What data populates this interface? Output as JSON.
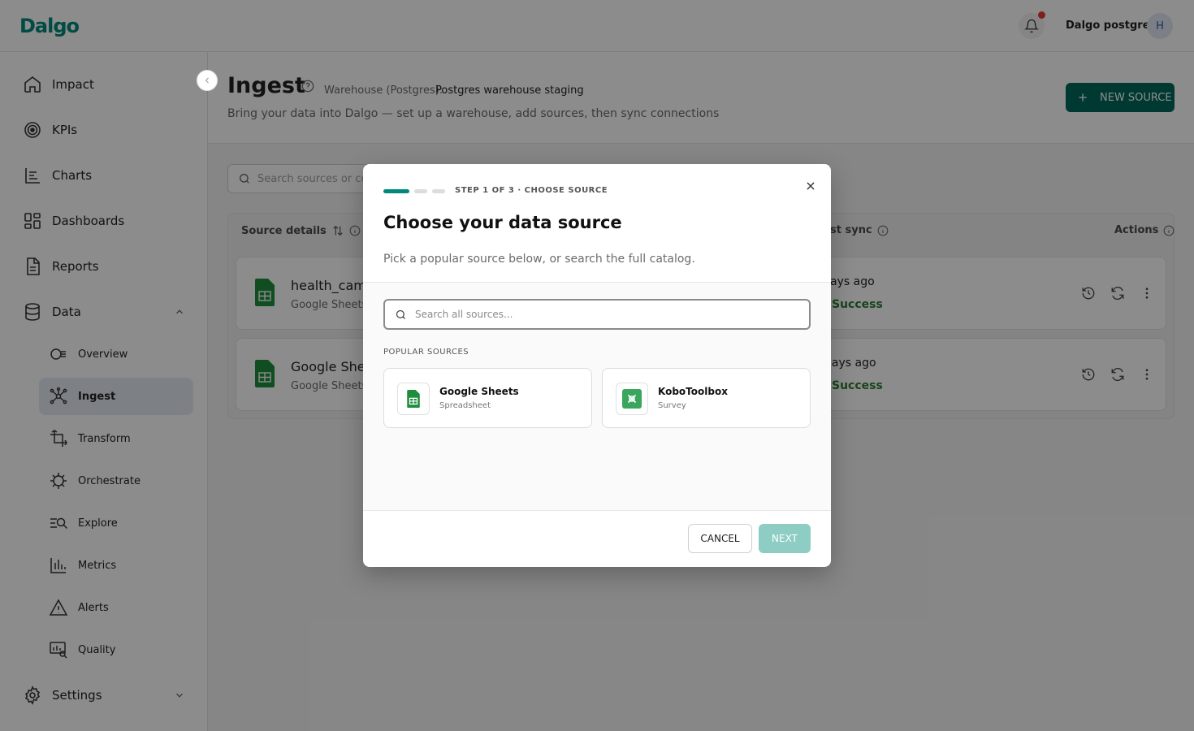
{
  "header": {
    "logo": "Dalgo",
    "user_name": "Dalgo postgres",
    "avatar_initial": "H"
  },
  "sidebar": {
    "items": [
      {
        "label": "Impact",
        "icon": "home-icon"
      },
      {
        "label": "KPIs",
        "icon": "target-icon"
      },
      {
        "label": "Charts",
        "icon": "chart-icon"
      },
      {
        "label": "Dashboards",
        "icon": "dashboard-icon"
      },
      {
        "label": "Reports",
        "icon": "report-icon"
      },
      {
        "label": "Data",
        "icon": "database-icon"
      },
      {
        "label": "Settings",
        "icon": "gear-icon"
      }
    ],
    "data_sub": [
      {
        "label": "Overview",
        "icon": "overview-icon"
      },
      {
        "label": "Ingest",
        "icon": "ingest-icon",
        "active": true
      },
      {
        "label": "Transform",
        "icon": "transform-icon"
      },
      {
        "label": "Orchestrate",
        "icon": "orchestrate-icon"
      },
      {
        "label": "Explore",
        "icon": "explore-icon"
      },
      {
        "label": "Metrics",
        "icon": "metrics-icon"
      },
      {
        "label": "Alerts",
        "icon": "alert-icon"
      },
      {
        "label": "Quality",
        "icon": "quality-icon"
      }
    ]
  },
  "page": {
    "title": "Ingest",
    "warehouse_label": "Warehouse (Postgres):",
    "warehouse_value": "Postgres warehouse staging",
    "subtitle": "Bring your data into Dalgo — set up a warehouse, add sources, then sync connections",
    "new_source_label": "NEW SOURCE",
    "search_placeholder": "Search sources or conn"
  },
  "table": {
    "col_source": "Source details",
    "col_sync": "st sync",
    "col_actions": "Actions",
    "rows": [
      {
        "name": "health_cam",
        "type": "Google Sheets",
        "time": "ays ago",
        "status": "Success"
      },
      {
        "name": "Google Shee",
        "type": "Google Sheets",
        "time": "lays ago",
        "status": "Success"
      }
    ]
  },
  "modal": {
    "step_label": "STEP 1 OF 3 · CHOOSE SOURCE",
    "title": "Choose your data source",
    "description": "Pick a popular source below, or search the full catalog.",
    "search_placeholder": "Search all sources...",
    "popular_label": "POPULAR SOURCES",
    "cards": [
      {
        "name": "Google Sheets",
        "sub": "Spreadsheet",
        "icon": "google-sheets-icon"
      },
      {
        "name": "KoboToolbox",
        "sub": "Survey",
        "icon": "kobotoolbox-icon"
      }
    ],
    "cancel_label": "CANCEL",
    "next_label": "NEXT"
  },
  "colors": {
    "primary": "#00695c",
    "primary_disabled": "#8ecdc3",
    "success": "#2e7d32",
    "sheets_green": "#1e8e3e",
    "alert_red": "#e53935"
  }
}
